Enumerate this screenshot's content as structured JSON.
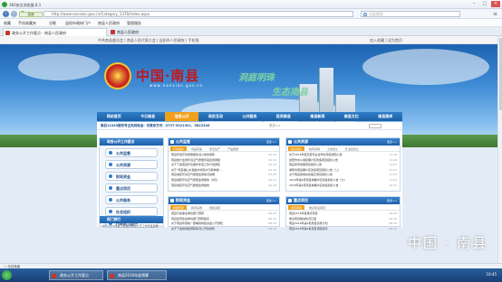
{
  "browser": {
    "title": "360安全浏览器 8.1",
    "mode_label": "极速",
    "address": "http://www.nanxian.gov.cn/Category_1376/Index.aspx",
    "search_placeholder": "点此搜索",
    "favorites": [
      "收藏",
      "手机收藏夹",
      "谷歌",
      "益阳市政府门户",
      "南县人民政府",
      "管理服务"
    ],
    "tabs": [
      {
        "label": "政务公开工作要点 - 南县人民政府"
      },
      {
        "label": "南县人民政府"
      }
    ],
    "status_left": "☆ 今日特卖"
  },
  "site": {
    "topline_links": "中共南县委员会  |  南县人民代表大会  |  益阳市人民政府  |  手机版",
    "topline_right": "加入收藏  |  设为首页",
    "title": "中国·南县",
    "url_text": "www.nanxian.gov.cn",
    "slogan_1": "洞庭明珠",
    "slogan_2": "生态南县",
    "nav": [
      "网站首页",
      "今日南县",
      "信息公开",
      "政民互动",
      "公共服务",
      "投资南县",
      "南县新闻",
      "南县文化",
      "南县图库"
    ],
    "nav_active_index": 2,
    "notice": "南县12345服务号主热线电话：先联系方式：0737-5221301、5822345",
    "notice_more": "更多>>"
  },
  "left": {
    "header": "政务公开工作要点",
    "items": [
      "公共监督",
      "公共资源",
      "财政资金",
      "重点项目",
      "公共服务",
      "社会组织",
      "行政权力运行"
    ],
    "header2": "热门排行",
    "text": "关于2016年度人民政府信息公开工作年度报告"
  },
  "panels": {
    "supervision": {
      "title": "公共监督",
      "more": "更多>>",
      "tabs": [
        "环境保护",
        "食品药品",
        "安全生产",
        "产品质量"
      ],
      "items": [
        {
          "t": "南县年度环境质量报告书公告的通知",
          "d": "09-30"
        },
        {
          "t": "南县统计监测环境空气质量年度监测通报",
          "d": "09-30"
        },
        {
          "t": "关于下发南县环境保护年度工作计划通知",
          "d": "09-29"
        },
        {
          "t": "关于“南县福山乡湘益村村民水污染举报”...",
          "d": "09-29"
        },
        {
          "t": "南县城区环境空气质量监测情况说明",
          "d": "09-28"
        },
        {
          "t": "南县城区环境空气质量监测报告（8月）",
          "d": "09-27"
        },
        {
          "t": "南县城区环境空气质量监测报告",
          "d": "09-26"
        }
      ]
    },
    "resources": {
      "title": "公共资源",
      "more": "更多>>",
      "tabs": [
        "招标投标",
        "政府采购",
        "土地出让",
        "矿业权出让"
      ],
      "items": [
        {
          "t": "关于2016年度农民专业合作社项目通知公告",
          "d": "11-10"
        },
        {
          "t": "益阳市中心城区棚户区改造项目招标公告",
          "d": "11-08"
        },
        {
          "t": "南县茅草街镇项目招标公告",
          "d": "11-07"
        },
        {
          "t": "湖南省南县棚户区改造项目招标公告（二）",
          "d": "11-07"
        },
        {
          "t": "关于南县易地扶贫搬迁项目招标公告",
          "d": "11-03"
        },
        {
          "t": "2016年第6月南县城棚户区改造招标公告（七）",
          "d": "11-02"
        },
        {
          "t": "2016年第6月南县城棚户区改造招标公告",
          "d": "10-31"
        }
      ]
    },
    "finance": {
      "title": "财政资金",
      "more": "更多>>",
      "tabs": [
        "财政预算",
        "政府采购",
        "财政决算"
      ],
      "items": [
        {
          "t": "南县行政事业单位部门预算",
          "d": "08-25"
        },
        {
          "t": "南县经济建设单位部门预算报表",
          "d": "08-25"
        },
        {
          "t": "关于南县年度统一部署的财政资金公开通知",
          "d": "08-25"
        },
        {
          "t": "关于下发的财政预算情况公开的通知",
          "d": "08-24"
        }
      ]
    },
    "projects": {
      "title": "重点项目",
      "more": "更多>>",
      "tabs": [
        "项目审批",
        "重点建设项目"
      ],
      "items": [
        {
          "t": "南县2016年度重点项目",
          "d": "08-30"
        },
        {
          "t": "重点项目推进情况汇报",
          "d": "08-26"
        },
        {
          "t": "南县2016年第1批项目实施计划",
          "d": "08-26"
        },
        {
          "t": "南县2016年第1批项目调度情况",
          "d": "08-25"
        }
      ]
    }
  },
  "taskbar": {
    "items": [
      "政务公开工作要点",
      "南县2016年度预算"
    ],
    "clock": "10:45"
  },
  "watermark": "中国 · 南县"
}
